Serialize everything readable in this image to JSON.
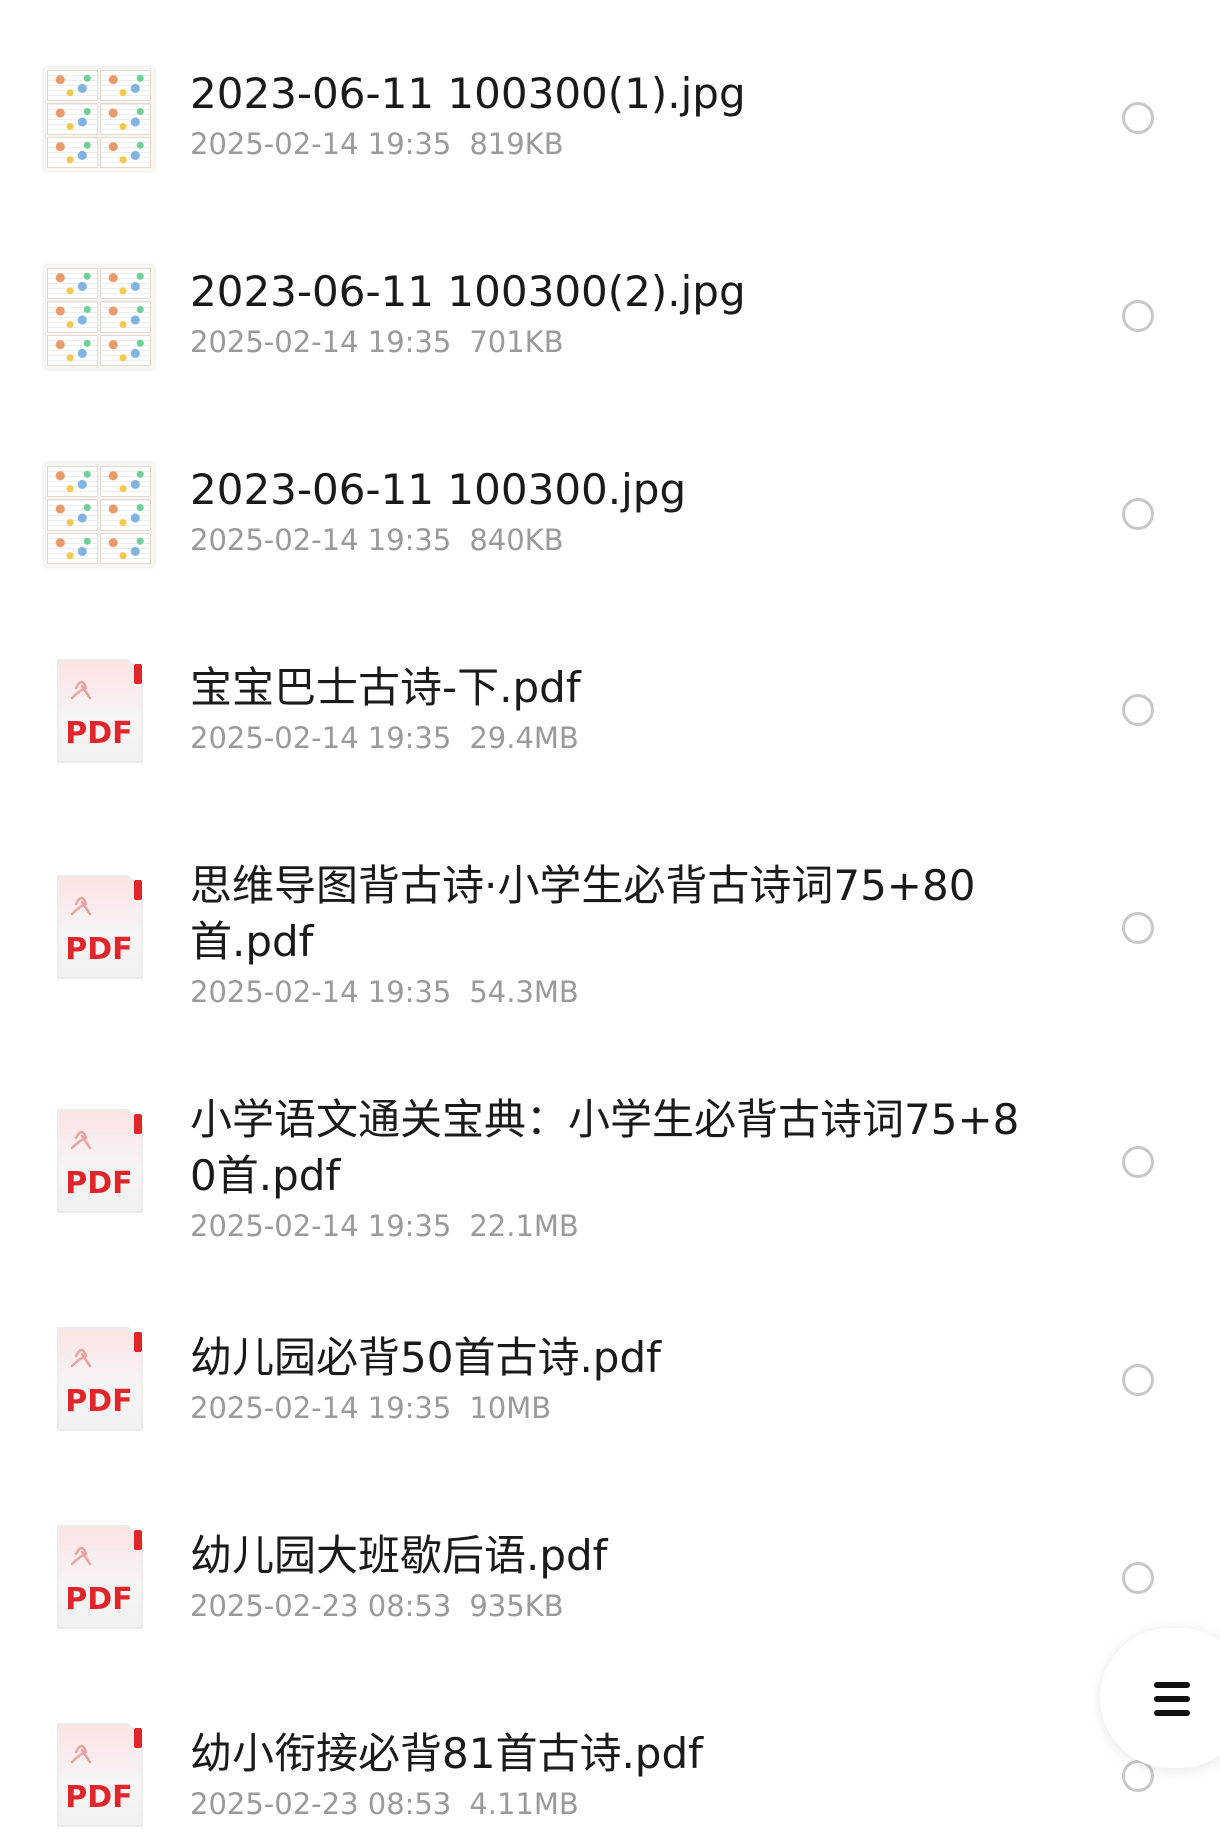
{
  "files": [
    {
      "name": "2023-06-11 100300(1).jpg",
      "date": "2025-02-14 19:35",
      "size": "819KB",
      "type": "image",
      "icon": "image-thumbnail-icon"
    },
    {
      "name": "2023-06-11 100300(2).jpg",
      "date": "2025-02-14 19:35",
      "size": "701KB",
      "type": "image",
      "icon": "image-thumbnail-icon"
    },
    {
      "name": "2023-06-11 100300.jpg",
      "date": "2025-02-14 19:35",
      "size": "840KB",
      "type": "image",
      "icon": "image-thumbnail-icon"
    },
    {
      "name": "宝宝巴士古诗-下.pdf",
      "date": "2025-02-14 19:35",
      "size": "29.4MB",
      "type": "pdf",
      "icon": "pdf-file-icon"
    },
    {
      "name": "思维导图背古诗·小学生必背古诗词75+80首.pdf",
      "date": "2025-02-14 19:35",
      "size": "54.3MB",
      "type": "pdf",
      "icon": "pdf-file-icon"
    },
    {
      "name": "小学语文通关宝典：小学生必背古诗词75+80首.pdf",
      "date": "2025-02-14 19:35",
      "size": "22.1MB",
      "type": "pdf",
      "icon": "pdf-file-icon"
    },
    {
      "name": "幼儿园必背50首古诗.pdf",
      "date": "2025-02-14 19:35",
      "size": "10MB",
      "type": "pdf",
      "icon": "pdf-file-icon"
    },
    {
      "name": "幼儿园大班歇后语.pdf",
      "date": "2025-02-23 08:53",
      "size": "935KB",
      "type": "pdf",
      "icon": "pdf-file-icon"
    },
    {
      "name": "幼小衔接必背81首古诗.pdf",
      "date": "2025-02-23 08:53",
      "size": "4.11MB",
      "type": "pdf",
      "icon": "pdf-file-icon"
    }
  ],
  "pdf_badge": "PDF",
  "fab": {
    "icon": "menu-icon"
  },
  "colors": {
    "pdf_red": "#e0262b",
    "meta_gray": "#9a9a9a",
    "radio_gray": "#c8c8c8"
  }
}
